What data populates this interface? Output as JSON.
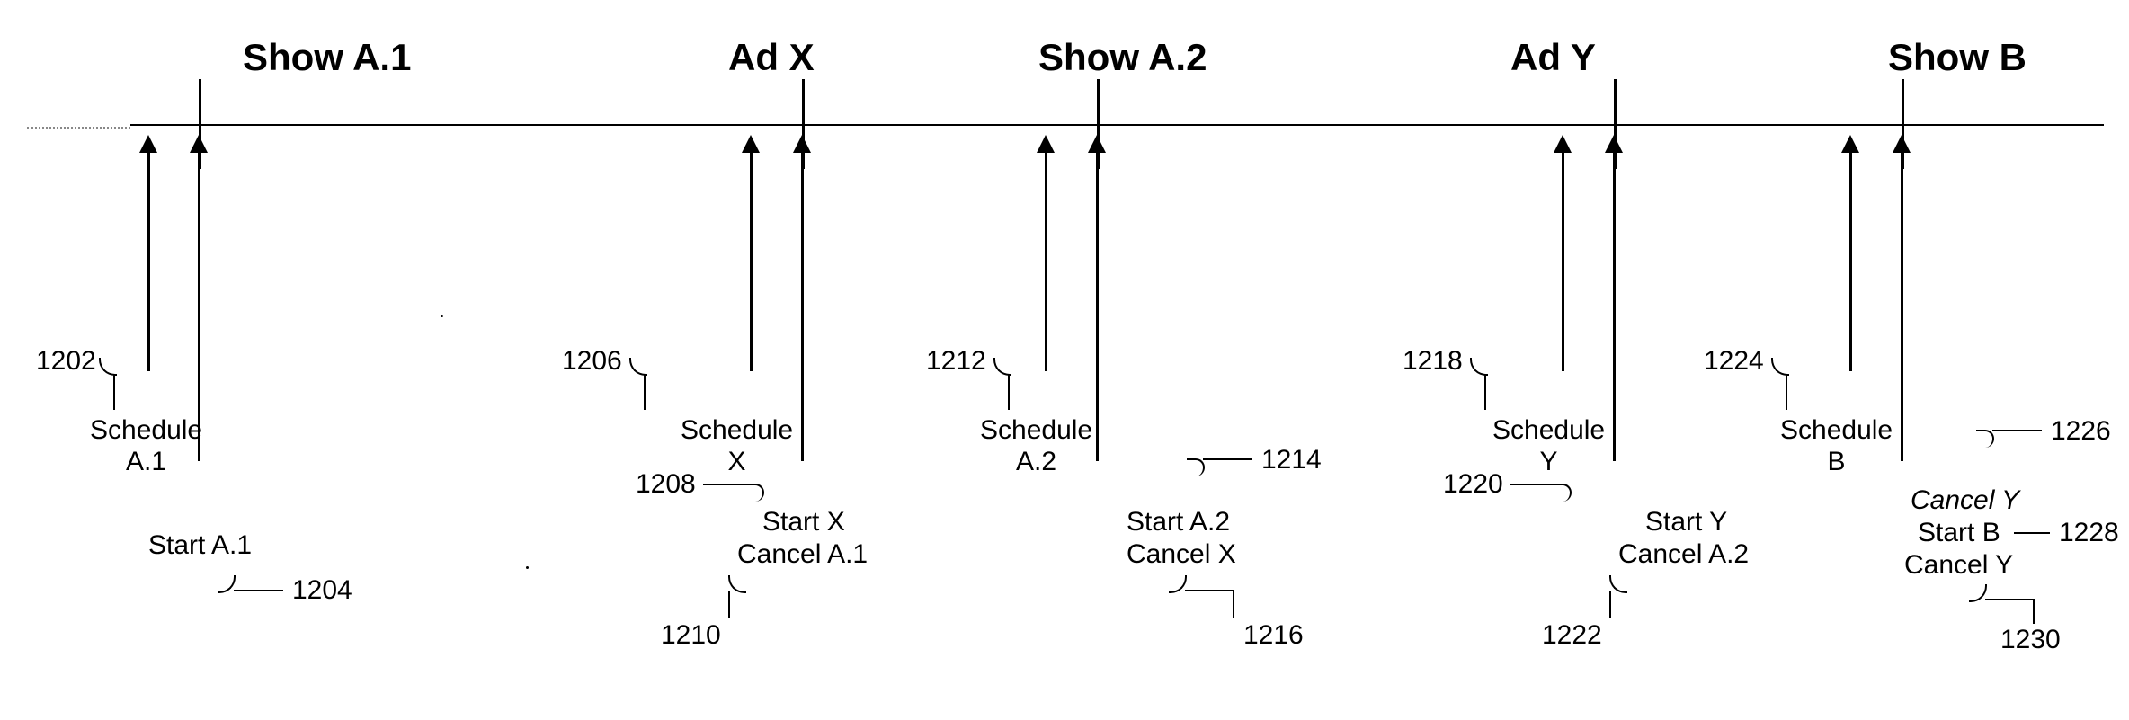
{
  "segments": {
    "show_a1": "Show A.1",
    "ad_x": "Ad X",
    "show_a2": "Show A.2",
    "ad_y": "Ad Y",
    "show_b": "Show B"
  },
  "events": {
    "schedule_a1": {
      "lines": [
        "Schedule",
        "A.1"
      ],
      "ref": "1202"
    },
    "start_a1": {
      "lines": [
        "Start A.1"
      ],
      "ref": "1204"
    },
    "schedule_x": {
      "lines": [
        "Schedule",
        "X"
      ],
      "ref": "1206"
    },
    "start_x": {
      "lines": [
        "Start X"
      ],
      "ref": "1208"
    },
    "cancel_a1": {
      "lines": [
        "Cancel A.1"
      ],
      "ref": "1210"
    },
    "schedule_a2": {
      "lines": [
        "Schedule",
        "A.2"
      ],
      "ref": "1212"
    },
    "start_a2": {
      "lines": [
        "Start A.2"
      ],
      "ref": "1214"
    },
    "cancel_x": {
      "lines": [
        "Cancel X"
      ],
      "ref": "1216"
    },
    "schedule_y": {
      "lines": [
        "Schedule",
        "Y"
      ],
      "ref": "1218"
    },
    "start_y": {
      "lines": [
        "Start Y"
      ],
      "ref": "1220"
    },
    "cancel_a2": {
      "lines": [
        "Cancel A.2"
      ],
      "ref": "1222"
    },
    "schedule_b": {
      "lines": [
        "Schedule",
        "B"
      ],
      "ref": "1224"
    },
    "cancel_y_it": {
      "lines": [
        "Cancel Y"
      ],
      "ref": "1226"
    },
    "start_b": {
      "lines": [
        "Start B"
      ],
      "ref": "1228"
    },
    "cancel_y": {
      "lines": [
        "Cancel Y"
      ],
      "ref": "1230"
    }
  }
}
